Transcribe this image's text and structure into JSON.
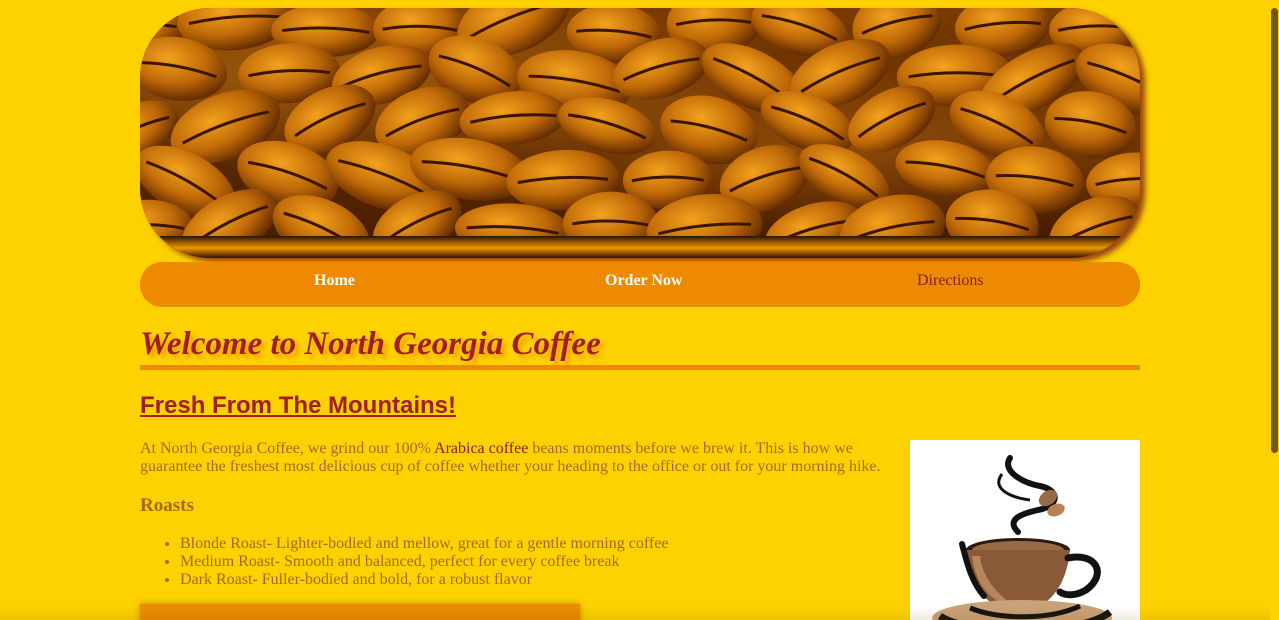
{
  "banner": {
    "image": "coffee-beans-banner"
  },
  "nav": {
    "home": "Home",
    "order": "Order Now",
    "directions": "Directions"
  },
  "main": {
    "welcome_title": "Welcome to North Georgia Coffee",
    "subtitle": "Fresh From The Mountains!",
    "intro_before": "At North Georgia Coffee, we grind our 100% ",
    "intro_link": "Arabica coffee",
    "intro_after": " beans moments before we brew it. This is how we guarantee the freshest most delicious cup of coffee whether your heading to the office or out for your morning hike.",
    "roasts_heading": "Roasts",
    "roasts": [
      "Blonde Roast- Lighter-bodied and mellow, great for a gentle morning coffee",
      "Medium Roast- Smooth and balanced, perfect for every coffee break",
      "Dark Roast- Fuller-bodied and bold, for a robust flavor"
    ]
  },
  "colors": {
    "background": "#fdd200",
    "nav": "#ee8a00",
    "heading": "#a11e1e",
    "body_text": "#a86818",
    "link": "#8a1a14"
  },
  "icons": {
    "cup": "coffee-cup-icon"
  }
}
